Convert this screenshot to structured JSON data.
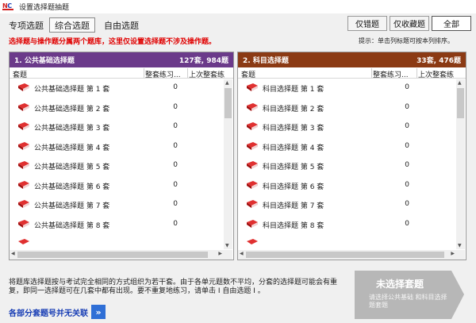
{
  "window": {
    "title": "设置选择题抽题",
    "logo_text": "NC"
  },
  "tabs": [
    {
      "label": "专项选题",
      "active": false
    },
    {
      "label": "综合选题",
      "active": true
    },
    {
      "label": "自由选题",
      "active": false
    }
  ],
  "filters": [
    {
      "label": "仅错题",
      "active": false
    },
    {
      "label": "仅收藏题",
      "active": false
    },
    {
      "label": "全部",
      "active": true
    }
  ],
  "warning": "选择题与操作题分属两个题库，这里仅设置选择题不涉及操作题。",
  "hint": "提示：单击列标题可按本列排序。",
  "columns": {
    "name": "套题",
    "practice": "整套练习...",
    "last": "上次整套练"
  },
  "left_panel": {
    "title": "1. 公共基础选择题",
    "summary": "127套, 984题",
    "header_color": "#6b3a8a",
    "rows": [
      {
        "name": "公共基础选择题 第 1 套",
        "count": "0"
      },
      {
        "name": "公共基础选择题 第 2 套",
        "count": "0"
      },
      {
        "name": "公共基础选择题 第 3 套",
        "count": "0"
      },
      {
        "name": "公共基础选择题 第 4 套",
        "count": "0"
      },
      {
        "name": "公共基础选择题 第 5 套",
        "count": "0"
      },
      {
        "name": "公共基础选择题 第 6 套",
        "count": "0"
      },
      {
        "name": "公共基础选择题 第 7 套",
        "count": "0"
      },
      {
        "name": "公共基础选择题 第 8 套",
        "count": "0"
      }
    ]
  },
  "right_panel": {
    "title": "2. 科目选择题",
    "summary": "33套, 476题",
    "header_color": "#8b3a14",
    "rows": [
      {
        "name": "科目选择题 第 1 套",
        "count": "0"
      },
      {
        "name": "科目选择题 第 2 套",
        "count": "0"
      },
      {
        "name": "科目选择题 第 3 套",
        "count": "0"
      },
      {
        "name": "科目选择题 第 4 套",
        "count": "0"
      },
      {
        "name": "科目选择题 第 5 套",
        "count": "0"
      },
      {
        "name": "科目选择题 第 6 套",
        "count": "0"
      },
      {
        "name": "科目选择题 第 7 套",
        "count": "0"
      },
      {
        "name": "科目选择题 第 8 套",
        "count": "0"
      }
    ]
  },
  "description": "将题库选择题按与考试完全相同的方式组织为若干套。由于各单元题数不平均，分套的选择题可能会有重复，即同一选择题可在几套中都有出现。要不重复地练习，请单击 I 自由选题 I 。",
  "link_text": "各部分套题号并无关联",
  "link_arrow": "»",
  "start_button": {
    "title": "未选择套题",
    "subtitle": "请选择公共基础 和科目选择题套题"
  },
  "colors": {
    "warning": "#e00000",
    "book_red": "#c81818"
  },
  "icons": {
    "book": "red-book-icon",
    "link": "double-chevron-icon"
  }
}
